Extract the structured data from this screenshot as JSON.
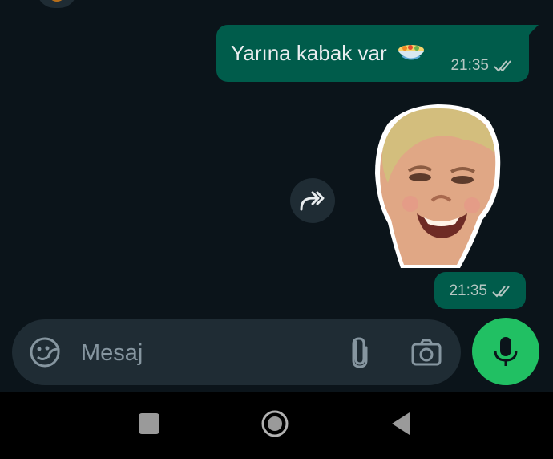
{
  "colors": {
    "background": "#0b141a",
    "outgoing_bubble": "#005c4b",
    "input_bar": "#1f2c34",
    "accent_green": "#21c063"
  },
  "messages": [
    {
      "type": "text",
      "text": "Yarına kabak var",
      "emoji": "dish-icon",
      "time": "21:35",
      "status": "read-double-tick-icon"
    },
    {
      "type": "sticker",
      "sticker": "toddler-face-sticker",
      "time": "21:35",
      "status": "read-double-tick-icon"
    }
  ],
  "forward_icon": "forward-icon",
  "composer": {
    "placeholder": "Mesaj",
    "value": "",
    "left_icon": "sticker-icon",
    "icons": [
      "paperclip-icon",
      "camera-icon"
    ],
    "send_icon": "microphone-icon"
  },
  "navigation": {
    "buttons": [
      "recents-icon",
      "home-icon",
      "back-icon"
    ]
  }
}
